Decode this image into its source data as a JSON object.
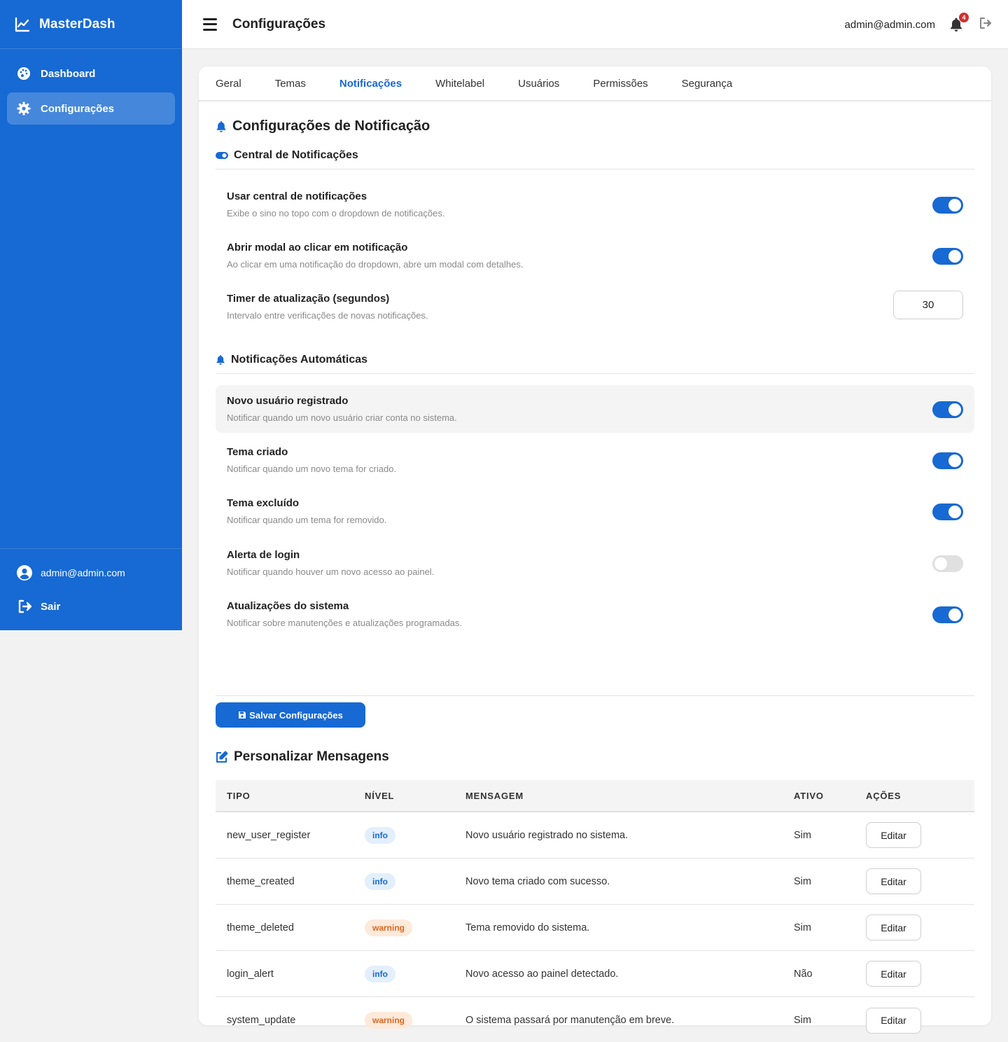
{
  "app": {
    "name": "MasterDash"
  },
  "sidebar": {
    "items": [
      {
        "label": "Dashboard",
        "icon": "palette-icon",
        "active": false
      },
      {
        "label": "Configurações",
        "icon": "gear-icon",
        "active": true
      }
    ],
    "user_email": "admin@admin.com",
    "logout_label": "Sair"
  },
  "topbar": {
    "title": "Configurações",
    "email": "admin@admin.com",
    "notification_count": "4"
  },
  "tabs": [
    {
      "label": "Geral",
      "active": false
    },
    {
      "label": "Temas",
      "active": false
    },
    {
      "label": "Notificações",
      "active": true
    },
    {
      "label": "Whitelabel",
      "active": false
    },
    {
      "label": "Usuários",
      "active": false
    },
    {
      "label": "Permissões",
      "active": false
    },
    {
      "label": "Segurança",
      "active": false
    }
  ],
  "notifications": {
    "title": "Configurações de Notificação",
    "central": {
      "title": "Central de Notificações",
      "rows": [
        {
          "label": "Usar central de notificações",
          "desc": "Exibe o sino no topo com o dropdown de notificações.",
          "enabled": true
        },
        {
          "label": "Abrir modal ao clicar em notificação",
          "desc": "Ao clicar em uma notificação do dropdown, abre um modal com detalhes.",
          "enabled": true
        }
      ],
      "timer": {
        "label": "Timer de atualização (segundos)",
        "desc": "Intervalo entre verificações de novas notificações.",
        "value": "30"
      }
    },
    "auto": {
      "title": "Notificações Automáticas",
      "rows": [
        {
          "label": "Novo usuário registrado",
          "desc": "Notificar quando um novo usuário criar conta no sistema.",
          "enabled": true
        },
        {
          "label": "Tema criado",
          "desc": "Notificar quando um novo tema for criado.",
          "enabled": true
        },
        {
          "label": "Tema excluído",
          "desc": "Notificar quando um tema for removido.",
          "enabled": true
        },
        {
          "label": "Alerta de login",
          "desc": "Notificar quando houver um novo acesso ao painel.",
          "enabled": false
        },
        {
          "label": "Atualizações do sistema",
          "desc": "Notificar sobre manutenções e atualizações programadas.",
          "enabled": true
        }
      ]
    },
    "save_label": "Salvar Configurações"
  },
  "messages": {
    "title": "Personalizar Mensagens",
    "headers": [
      "TIPO",
      "NÍVEL",
      "MENSAGEM",
      "ATIVO",
      "AÇÕES"
    ],
    "edit_label": "Editar",
    "rows": [
      {
        "tipo": "new_user_register",
        "nivel": "info",
        "mensagem": "Novo usuário registrado no sistema.",
        "ativo": "Sim"
      },
      {
        "tipo": "theme_created",
        "nivel": "info",
        "mensagem": "Novo tema criado com sucesso.",
        "ativo": "Sim"
      },
      {
        "tipo": "theme_deleted",
        "nivel": "warning",
        "mensagem": "Tema removido do sistema.",
        "ativo": "Sim"
      },
      {
        "tipo": "login_alert",
        "nivel": "info",
        "mensagem": "Novo acesso ao painel detectado.",
        "ativo": "Não"
      },
      {
        "tipo": "system_update",
        "nivel": "warning",
        "mensagem": "O sistema passará por manutenção em breve.",
        "ativo": "Sim"
      }
    ]
  },
  "colors": {
    "primary": "#1769d3",
    "badge": "#d32f2f",
    "warning": "#e0651e"
  }
}
